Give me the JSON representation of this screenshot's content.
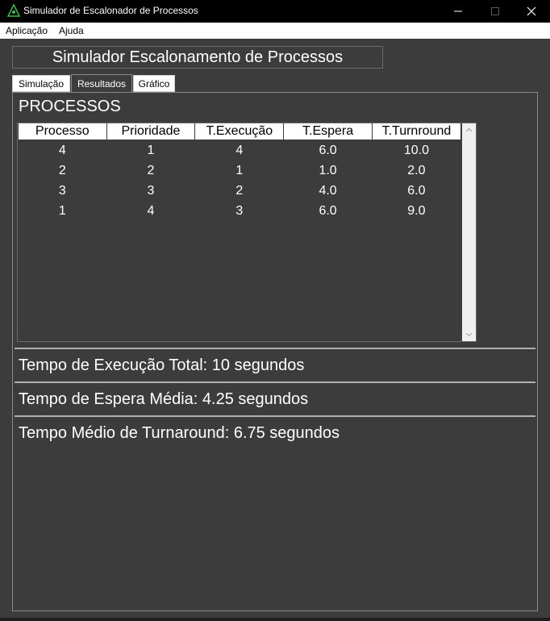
{
  "window": {
    "title": "Simulador de Escalonador de Processos",
    "controls": {
      "minimize": "minimize-icon",
      "maximize": "maximize-icon",
      "close": "close-icon"
    }
  },
  "menu": {
    "items": [
      "Aplicação",
      "Ajuda"
    ]
  },
  "header": {
    "title": "Simulador Escalonamento de Processos"
  },
  "tabs": [
    {
      "label": "Simulação",
      "selected": false
    },
    {
      "label": "Resultados",
      "selected": true
    },
    {
      "label": "Gráfico",
      "selected": false
    }
  ],
  "section": {
    "title": "PROCESSOS"
  },
  "table": {
    "columns": [
      "Processo",
      "Prioridade",
      "T.Execução",
      "T.Espera",
      "T.Turnround"
    ],
    "rows": [
      [
        "4",
        "1",
        "4",
        "6.0",
        "10.0"
      ],
      [
        "2",
        "2",
        "1",
        "1.0",
        "2.0"
      ],
      [
        "3",
        "3",
        "2",
        "4.0",
        "6.0"
      ],
      [
        "1",
        "4",
        "3",
        "6.0",
        "9.0"
      ]
    ]
  },
  "stats": {
    "total_exec": "Tempo de Execução Total: 10 segundos",
    "avg_wait": "Tempo de Espera Média: 4.25 segundos",
    "avg_turnaround": "Tempo Médio de Turnaround: 6.75 segundos"
  },
  "colors": {
    "background": "#3c3c3c",
    "titlebar": "#000000",
    "text": "#ffffff",
    "header_cell": "#ffffff"
  }
}
